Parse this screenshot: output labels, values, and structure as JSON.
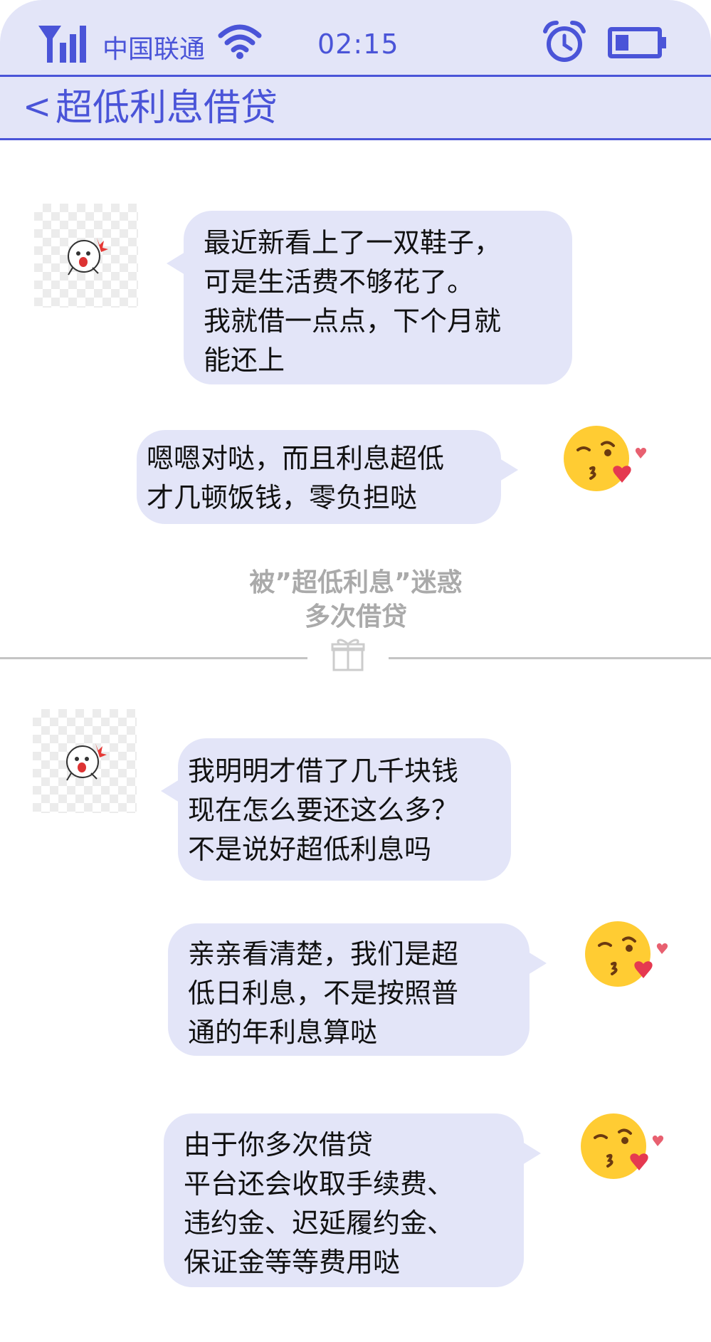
{
  "status_bar": {
    "carrier": "中国联通",
    "time": "02:15",
    "icons": [
      "signal-icon",
      "wifi-icon",
      "alarm-clock-icon",
      "battery-icon"
    ]
  },
  "header": {
    "back_glyph": "<",
    "title": "超低利息借贷"
  },
  "messages": [
    {
      "side": "left",
      "lines": [
        "最近新看上了一双鞋子，",
        "可是生活费不够花了。",
        "我就借一点点，下个月就",
        "能还上"
      ]
    },
    {
      "side": "right",
      "lines": [
        "嗯嗯对哒，而且利息超低",
        "才几顿饭钱，零负担哒"
      ]
    },
    {
      "side": "left",
      "lines": [
        "我明明才借了几千块钱",
        "现在怎么要还这么多？",
        "不是说好超低利息吗"
      ]
    },
    {
      "side": "right",
      "lines": [
        "亲亲看清楚，我们是超",
        "低日利息，不是按照普",
        "通的年利息算哒"
      ]
    },
    {
      "side": "right",
      "lines": [
        "由于你多次借贷",
        "平台还会收取手续费、",
        "违约金、迟延履约金、",
        "保证金等等费用哒"
      ]
    }
  ],
  "divider": {
    "lines": [
      "被”超低利息”迷惑",
      "多次借贷"
    ],
    "icon": "gift-icon"
  },
  "colors": {
    "accent": "#4a54d8",
    "bubble": "#e3e5f8",
    "divider_text": "#aaaaaa"
  }
}
